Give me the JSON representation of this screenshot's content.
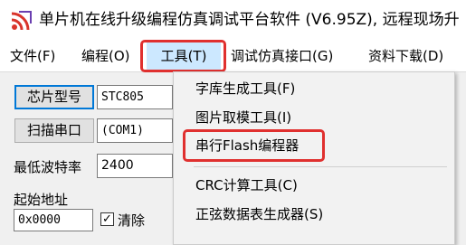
{
  "window": {
    "title": "单片机在线升级编程仿真调试平台软件 (V6.95Z), 远程现场升"
  },
  "menubar": {
    "items": [
      {
        "label": "文件(F)"
      },
      {
        "label": "编程(O)"
      },
      {
        "label": "工具(T)"
      },
      {
        "label": "调试仿真接口(G)"
      },
      {
        "label": "资料下载(D)"
      }
    ]
  },
  "left_panel": {
    "chip_type_button": "芯片型号",
    "chip_type_value": "STC805",
    "scan_port_button": "扫描串口",
    "port_value": "(COM1)",
    "min_baud_label": "最低波特率",
    "min_baud_value": "2400",
    "start_address_label": "起始地址",
    "start_address_value": "0x0000",
    "clear_label": "清除"
  },
  "tools_menu": {
    "items": [
      {
        "label": "字库生成工具(F)"
      },
      {
        "label": "图片取模工具(I)"
      },
      {
        "label": "串行Flash编程器"
      },
      {
        "label": "CRC计算工具(C)"
      },
      {
        "label": "正弦数据表生成器(S)"
      }
    ]
  },
  "colors": {
    "highlight": "#e0302f",
    "menu_active": "#cce8ff",
    "focus_border": "#0078d7"
  }
}
